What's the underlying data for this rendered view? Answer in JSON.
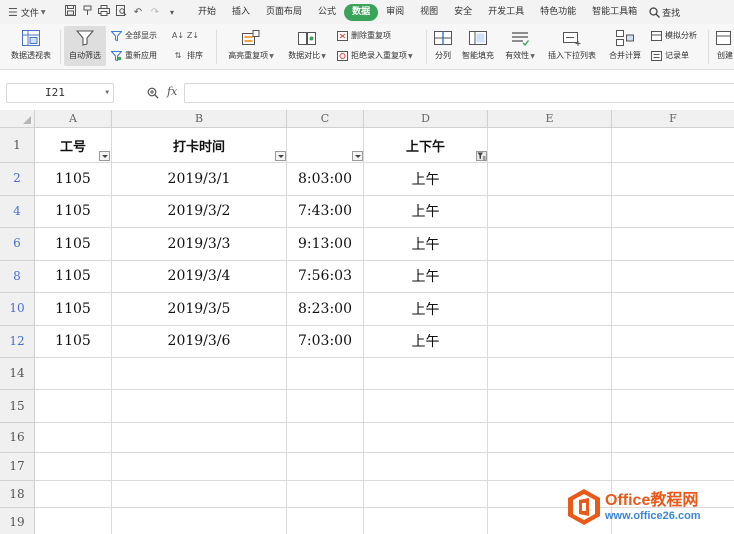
{
  "menubar": {
    "file_label": "文件",
    "tabs": [
      "开始",
      "插入",
      "页面布局",
      "公式",
      "数据",
      "审阅",
      "视图",
      "安全",
      "开发工具",
      "特色功能",
      "智能工具箱"
    ],
    "active_tab": "数据",
    "search_label": "查找"
  },
  "ribbon": {
    "pivot_table": "数据透视表",
    "auto_filter": "自动筛选",
    "show_all": "全部显示",
    "reapply": "重新应用",
    "sort": "排序",
    "highlight_dup": "高亮重复项",
    "compare": "数据对比",
    "remove_dup": "删除重复项",
    "reject_dup": "拒绝录入重复项",
    "split": "分列",
    "flash_fill": "智能填充",
    "validity": "有效性",
    "dropdown_list": "插入下拉列表",
    "consolidate": "合并计算",
    "what_if": "模拟分析",
    "record_form": "记录单",
    "create": "创建"
  },
  "formula_bar": {
    "cell_ref": "I21",
    "fx": "fx",
    "value": ""
  },
  "sheet": {
    "columns": [
      "A",
      "B",
      "C",
      "D",
      "E",
      "F"
    ],
    "header_row_number": "1",
    "headers": [
      "工号",
      "打卡时间",
      "",
      "上下午"
    ],
    "rows": [
      {
        "num": "2",
        "id": "1105",
        "date": "2019/3/1",
        "time": "8:03:00",
        "ampm": "上午"
      },
      {
        "num": "4",
        "id": "1105",
        "date": "2019/3/2",
        "time": "7:43:00",
        "ampm": "上午"
      },
      {
        "num": "6",
        "id": "1105",
        "date": "2019/3/3",
        "time": "9:13:00",
        "ampm": "上午"
      },
      {
        "num": "8",
        "id": "1105",
        "date": "2019/3/4",
        "time": "7:56:03",
        "ampm": "上午"
      },
      {
        "num": "10",
        "id": "1105",
        "date": "2019/3/5",
        "time": "8:23:00",
        "ampm": "上午"
      },
      {
        "num": "12",
        "id": "1105",
        "date": "2019/3/6",
        "time": "7:03:00",
        "ampm": "上午"
      }
    ],
    "empty_row_numbers": [
      "14",
      "15",
      "16",
      "17",
      "18",
      "19"
    ]
  },
  "watermark": {
    "brand": "Office教程网",
    "url": "www.office26.com"
  },
  "colors": {
    "active_tab": "#3aa35a",
    "filtered_row_number": "#4a6fd0",
    "watermark_orange": "#e8591a",
    "watermark_blue": "#3b87d4"
  }
}
